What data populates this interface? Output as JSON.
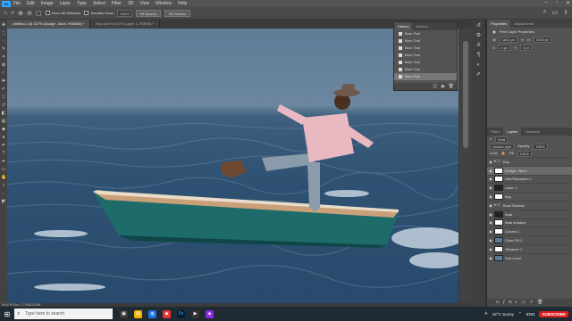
{
  "menubar": {
    "logo": "Ps",
    "items": [
      "File",
      "Edit",
      "Image",
      "Layer",
      "Type",
      "Select",
      "Filter",
      "3D",
      "View",
      "Window",
      "Help"
    ]
  },
  "options": {
    "zoom_all_windows": "Zoom All Windows",
    "scrubby_zoom": "Scrubby Zoom",
    "zoom_value": "100%",
    "fit_screen": "Fit Screen",
    "fill_screen": "Fill Screen"
  },
  "tabs": [
    "Untitled-1 @ 107% (Dodge - Burn, RGB/8#) *",
    "Boy and Sl 167% (Layer 1, RGB/8) *"
  ],
  "history": {
    "tabs": [
      "History",
      "Actions"
    ],
    "items": [
      "Burn Tool",
      "Burn Tool",
      "Burn Tool",
      "Burn Tool",
      "Burn Tool",
      "Burn Tool",
      "Burn Tool"
    ]
  },
  "properties": {
    "title": "Properties",
    "tab2": "Adjustments",
    "subtitle": "Pixel Layer Properties",
    "w_label": "W",
    "w_value": "1610 px",
    "h_label": "H",
    "h_value": "2320 px",
    "x_label": "X",
    "x_value": "0 px",
    "y_label": "Y",
    "y_value": "0 px"
  },
  "layers": {
    "tabs": [
      "Paths",
      "Layers",
      "Channels"
    ],
    "kind": "Kind",
    "blend_mode": "Linear Light",
    "opacity_label": "Opacity",
    "opacity_value": "100%",
    "lock_label": "Lock",
    "fill_label": "Fill",
    "fill_value": "100%",
    "rows": [
      {
        "name": "Boy",
        "thumb": "folder"
      },
      {
        "name": "Dodge - Burn",
        "thumb": "white"
      },
      {
        "name": "Hue/Saturation 1",
        "thumb": "white"
      },
      {
        "name": "Layer 1",
        "thumb": "dark"
      },
      {
        "name": "Boy",
        "thumb": "white"
      },
      {
        "name": "Boat Shadow",
        "thumb": "folder"
      },
      {
        "name": "Boat",
        "thumb": "dark"
      },
      {
        "name": "Boat shadow",
        "thumb": "white"
      },
      {
        "name": "Curves 1",
        "thumb": "white"
      },
      {
        "name": "Color Fill 1",
        "thumb": "blue"
      },
      {
        "name": "Vibrance 1",
        "thumb": "white"
      },
      {
        "name": "Sea Level",
        "thumb": "blue"
      }
    ]
  },
  "status": "66.67%    Doc: 2.71M/120.6M",
  "taskbar": {
    "search_placeholder": "Type here to search",
    "weather": "32°C  Sunny",
    "lang": "ENG",
    "subscribe": "SUBSCRIBE"
  }
}
